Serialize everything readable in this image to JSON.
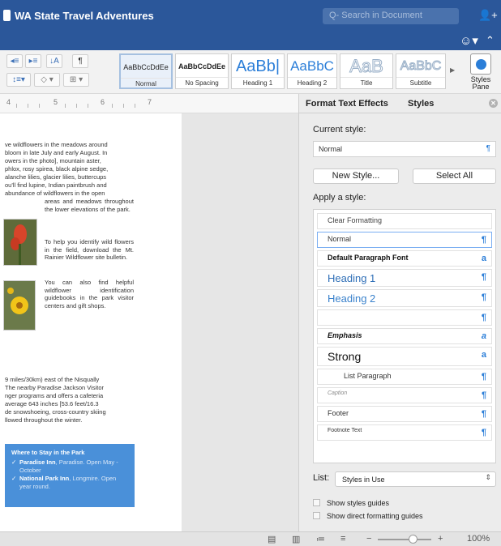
{
  "window": {
    "title": "WA State Travel Adventures"
  },
  "search": {
    "placeholder": "Q- Search in Document"
  },
  "toolbar": {
    "gallery": [
      {
        "preview": "AaBbCcDdEe",
        "label": "Normal"
      },
      {
        "preview": "AaBbCcDdEe",
        "label": "No Spacing"
      },
      {
        "preview": "AaBb|",
        "label": "Heading 1"
      },
      {
        "preview": "AaBbC",
        "label": "Heading 2"
      },
      {
        "preview": "AaB",
        "label": "Title"
      },
      {
        "preview": "AaBbC",
        "label": "Subtitle"
      }
    ],
    "styles_pane_label_1": "Styles",
    "styles_pane_label_2": "Pane"
  },
  "ruler": {
    "marks": [
      "4",
      "5",
      "6",
      "7"
    ]
  },
  "document": {
    "top_lines": [
      "ve wildflowers in the meadows around",
      "bloom in late July and early August. In",
      "owers in the photo], mountain aster,",
      "phlox, rosy spirea, black alpine sedge,",
      "alanche lilies, glacier lilies, buttercups",
      "ou'll find lupine, Indian paintbrush and",
      "abundance of wildflowers in the open"
    ],
    "side_text_1": "areas and meadows throughout the lower elevations of the park.",
    "side_text_2": "To help you identify wild flowers in the field, download the Mt. Rainier Wildflower site bulletin.",
    "side_text_3": "You can also find helpful wildflower identification guidebooks in the park visitor centers and gift shops.",
    "bottom_lines": [
      "9 miles/30km) east of the Nisqually",
      "The nearby Paradise Jackson Visitor",
      "nger programs and offers a cafeteria",
      "average 643 inches [53.6 feet/16.3",
      "de snowshoeing, cross-country skiing",
      "llowed throughout the winter."
    ],
    "callout": {
      "heading": "Where to Stay in the Park",
      "item1_name": "Paradise Inn",
      "item1_rest": ", Paradise. Open May - October",
      "item2_name": "National Park Inn",
      "item2_rest": ", Longmire. Open year round."
    }
  },
  "pane": {
    "tab_effects": "Format Text Effects",
    "tab_styles": "Styles",
    "current_style_label": "Current style:",
    "current_style_value": "Normal",
    "pilcrow": "¶",
    "new_style_button": "New Style...",
    "select_all_button": "Select All",
    "apply_label": "Apply a style:",
    "styles": [
      {
        "name": "Clear Formatting",
        "marker": ""
      },
      {
        "name": "Normal",
        "marker": "¶"
      },
      {
        "name": "Default Paragraph Font",
        "marker": "a"
      },
      {
        "name": "Heading 1",
        "marker": "¶"
      },
      {
        "name": "Heading 2",
        "marker": "¶"
      },
      {
        "name": "",
        "marker": "¶"
      },
      {
        "name": "Emphasis",
        "marker": "a"
      },
      {
        "name": "Strong",
        "marker": "a"
      },
      {
        "name": "List Paragraph",
        "marker": "¶"
      },
      {
        "name": "Caption",
        "marker": "¶"
      },
      {
        "name": "Footer",
        "marker": "¶"
      },
      {
        "name": "Footnote Text",
        "marker": "¶"
      }
    ],
    "list_label": "List:",
    "list_value": "Styles in Use",
    "show_styles_guides": "Show styles guides",
    "show_direct_formatting": "Show direct formatting guides"
  },
  "statusbar": {
    "zoom_minus": "−",
    "zoom_plus": "+",
    "zoom": "100%"
  }
}
